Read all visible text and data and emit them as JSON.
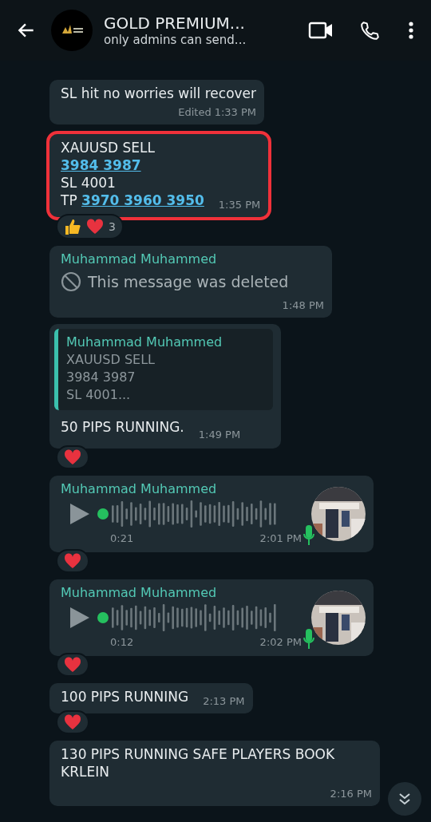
{
  "header": {
    "title": "GOLD PREMIUM...",
    "subtitle": "only admins can send..."
  },
  "messages": [
    {
      "kind": "text",
      "lines": [
        [
          {
            "text": "SL hit no worries will recover"
          }
        ]
      ],
      "edited": "Edited",
      "time": "1:33 PM",
      "highlighted": false
    },
    {
      "kind": "text",
      "lines": [
        [
          {
            "text": "XAUUSD SELL"
          }
        ],
        [
          {
            "text": "3984 3987",
            "link": true
          }
        ],
        [
          {
            "text": "SL 4001"
          }
        ],
        [
          {
            "text": "TP "
          },
          {
            "text": "3970 3960 3950",
            "link": true
          }
        ]
      ],
      "time": "1:35 PM",
      "highlighted": true,
      "reactions": [
        {
          "kind": "thumbs-up"
        },
        {
          "kind": "heart"
        }
      ],
      "reaction_count": "3"
    },
    {
      "kind": "deleted",
      "sender": "Muhammad Muhammed",
      "text": "This message was deleted",
      "time": "1:48 PM"
    },
    {
      "kind": "quote",
      "quote_sender": "Muhammad Muhammed",
      "quote_lines": [
        "XAUUSD SELL",
        "3984 3987",
        "SL 4001..."
      ],
      "text": "50 PIPS RUNNING.",
      "time": "1:49 PM",
      "reactions": [
        {
          "kind": "heart"
        }
      ]
    },
    {
      "kind": "voice",
      "sender": "Muhammad Muhammed",
      "duration": "0:21",
      "time": "2:01 PM",
      "reactions": [
        {
          "kind": "heart"
        }
      ]
    },
    {
      "kind": "voice",
      "sender": "Muhammad Muhammed",
      "duration": "0:12",
      "time": "2:02 PM",
      "reactions": [
        {
          "kind": "heart"
        }
      ]
    },
    {
      "kind": "text",
      "lines": [
        [
          {
            "text": "100 PIPS RUNNING"
          }
        ]
      ],
      "time": "2:13 PM",
      "highlighted": false,
      "reactions": [
        {
          "kind": "heart"
        }
      ]
    },
    {
      "kind": "text",
      "lines": [
        [
          {
            "text": "130 PIPS RUNNING SAFE PLAYERS BOOK KRLEIN"
          }
        ]
      ],
      "time": "2:16 PM",
      "highlighted": false
    }
  ]
}
